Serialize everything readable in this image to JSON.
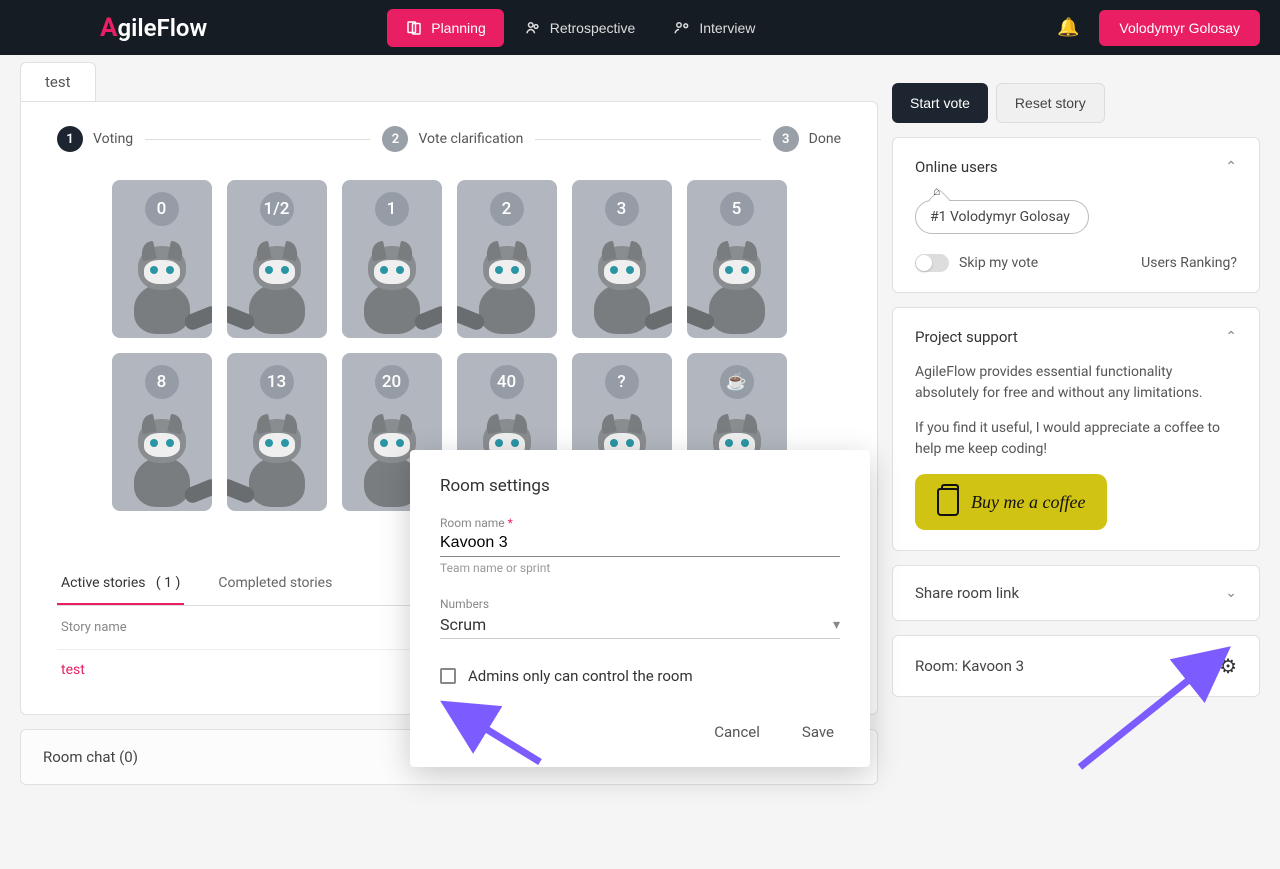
{
  "header": {
    "logo_text": "gileFlow",
    "nav": {
      "planning": "Planning",
      "retro": "Retrospective",
      "interview": "Interview"
    },
    "user": "Volodymyr Golosay"
  },
  "tab": "test",
  "steps": [
    {
      "num": "1",
      "label": "Voting"
    },
    {
      "num": "2",
      "label": "Vote clarification"
    },
    {
      "num": "3",
      "label": "Done"
    }
  ],
  "cards": [
    "0",
    "1/2",
    "1",
    "2",
    "3",
    "5",
    "8",
    "13",
    "20",
    "40",
    "?",
    "☕"
  ],
  "stories": {
    "tabs": {
      "active": "Active stories",
      "active_count": "( 1 )",
      "completed": "Completed stories"
    },
    "header": "Story name",
    "rows": [
      "test"
    ]
  },
  "chat": {
    "title": "Room chat (0)"
  },
  "right": {
    "start": "Start vote",
    "reset": "Reset story",
    "online_title": "Online users",
    "online_user": "#1 Volodymyr Golosay",
    "skip": "Skip my vote",
    "ranking": "Users Ranking?",
    "support_title": "Project support",
    "support_p1": "AgileFlow provides essential functionality absolutely for free and without any limitations.",
    "support_p2": "If you find it useful, I would appreciate a coffee to help me keep coding!",
    "coffee": "Buy me a coffee",
    "share": "Share room link",
    "room": "Room: Kavoon 3"
  },
  "dialog": {
    "title": "Room settings",
    "name_label": "Room name",
    "name_value": "Kavoon 3",
    "name_hint": "Team name or sprint",
    "numbers_label": "Numbers",
    "numbers_value": "Scrum",
    "admins_label": "Admins only can control the room",
    "cancel": "Cancel",
    "save": "Save"
  }
}
